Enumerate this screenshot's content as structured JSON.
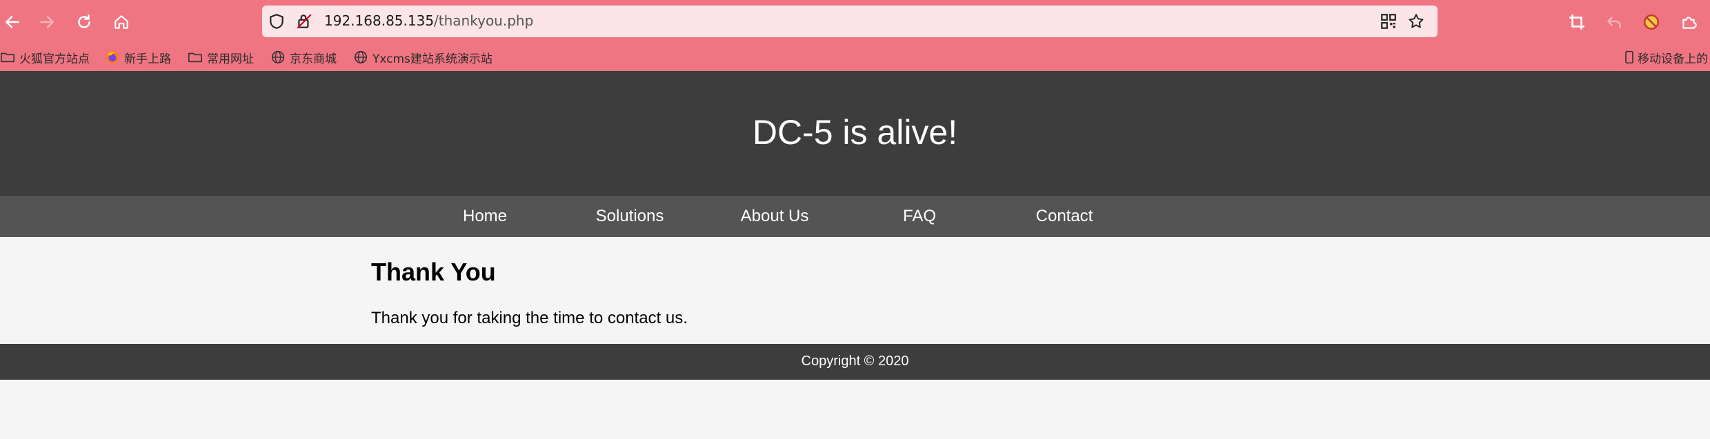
{
  "browser": {
    "address": {
      "host": "192.168.85.135",
      "path": "/thankyou.php"
    },
    "bookmarks": [
      {
        "label": "火狐官方站点",
        "icon": "folder-icon"
      },
      {
        "label": "新手上路",
        "icon": "firefox-icon"
      },
      {
        "label": "常用网址",
        "icon": "folder-icon"
      },
      {
        "label": "京东商城",
        "icon": "globe-icon"
      },
      {
        "label": "Yxcms建站系统演示站",
        "icon": "globe-icon"
      }
    ],
    "mobile_bookmark": "移动设备上的",
    "colors": {
      "chrome": "#f07582",
      "urlbar": "#fbe5e8"
    }
  },
  "site": {
    "title": "DC-5 is alive!",
    "nav": [
      "Home",
      "Solutions",
      "About Us",
      "FAQ",
      "Contact"
    ],
    "heading": "Thank You",
    "message": "Thank you for taking the time to contact us.",
    "footer": "Copyright © 2020",
    "colors": {
      "header": "#3d3d3d",
      "nav": "#545454",
      "body": "#f5f5f5"
    }
  }
}
